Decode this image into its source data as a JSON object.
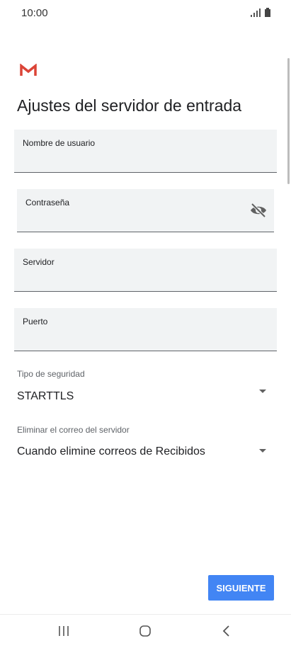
{
  "status_bar": {
    "time": "10:00",
    "icons": [
      "signal-icon",
      "battery-icon"
    ]
  },
  "app": {
    "logo_icon": "gmail-logo-icon",
    "accent_color": "#db4437"
  },
  "page": {
    "title": "Ajustes del servidor de entrada"
  },
  "form": {
    "username": {
      "label": "Nombre de usuario",
      "value": ""
    },
    "password": {
      "label": "Contraseña",
      "value": "",
      "toggle_icon": "visibility-off-icon"
    },
    "server": {
      "label": "Servidor",
      "value": ""
    },
    "port": {
      "label": "Puerto",
      "value": ""
    },
    "security": {
      "label": "Tipo de seguridad",
      "value": "STARTTLS"
    },
    "delete_mail": {
      "label": "Eliminar el correo del servidor",
      "value": "Cuando elimine correos de Recibidos"
    }
  },
  "actions": {
    "next_label": "SIGUIENTE",
    "button_color": "#4285f4"
  },
  "nav_bar": {
    "buttons": [
      "recent-apps-icon",
      "home-icon",
      "back-icon"
    ]
  }
}
